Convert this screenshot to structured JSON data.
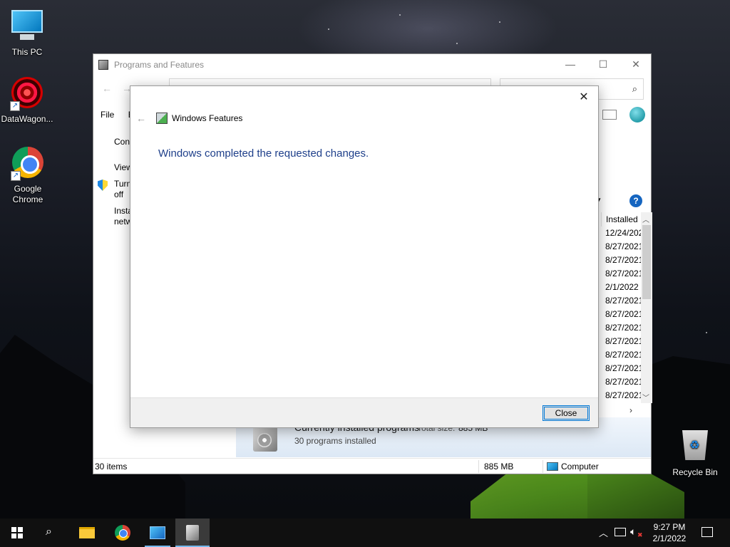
{
  "desktop": {
    "icons": [
      {
        "label": "This PC",
        "icon": "this-pc-icon"
      },
      {
        "label": "DataWagon...",
        "icon": "datawagon-icon"
      },
      {
        "label": "Google Chrome",
        "icon": "chrome-icon"
      },
      {
        "label": "Recycle Bin",
        "icon": "recycle-bin-icon"
      }
    ]
  },
  "programs_window": {
    "title": "Programs and Features",
    "menu": [
      "File",
      "Ed"
    ],
    "left_links": [
      "Cont",
      "View",
      "Turn",
      "off",
      "Insta",
      "netw"
    ],
    "installed_column_header": "Installed",
    "installed_dates": [
      "12/24/202",
      "8/27/2021",
      "8/27/2021",
      "8/27/2021",
      "2/1/2022",
      "8/27/2021",
      "8/27/2021",
      "8/27/2021",
      "8/27/2021",
      "8/27/2021",
      "8/27/2021",
      "8/27/2021",
      "8/27/2021"
    ],
    "details": {
      "title": "Currently installed programs",
      "total_size_label": "Total size:",
      "total_size": "885 MB",
      "count": "30 programs installed"
    },
    "status": {
      "items": "30 items",
      "size": "885 MB",
      "location": "Computer"
    }
  },
  "windows_features_dialog": {
    "title": "Windows Features",
    "message": "Windows completed the requested changes.",
    "close_button": "Close"
  },
  "taskbar": {
    "apps": [
      "start",
      "search",
      "file-explorer",
      "chrome",
      "control-panel",
      "programs-and-features"
    ],
    "time": "9:27 PM",
    "date": "2/1/2022"
  },
  "colors": {
    "dialog_message": "#1e3f8a",
    "taskbar": "#101010",
    "accent": "#0078d7"
  }
}
